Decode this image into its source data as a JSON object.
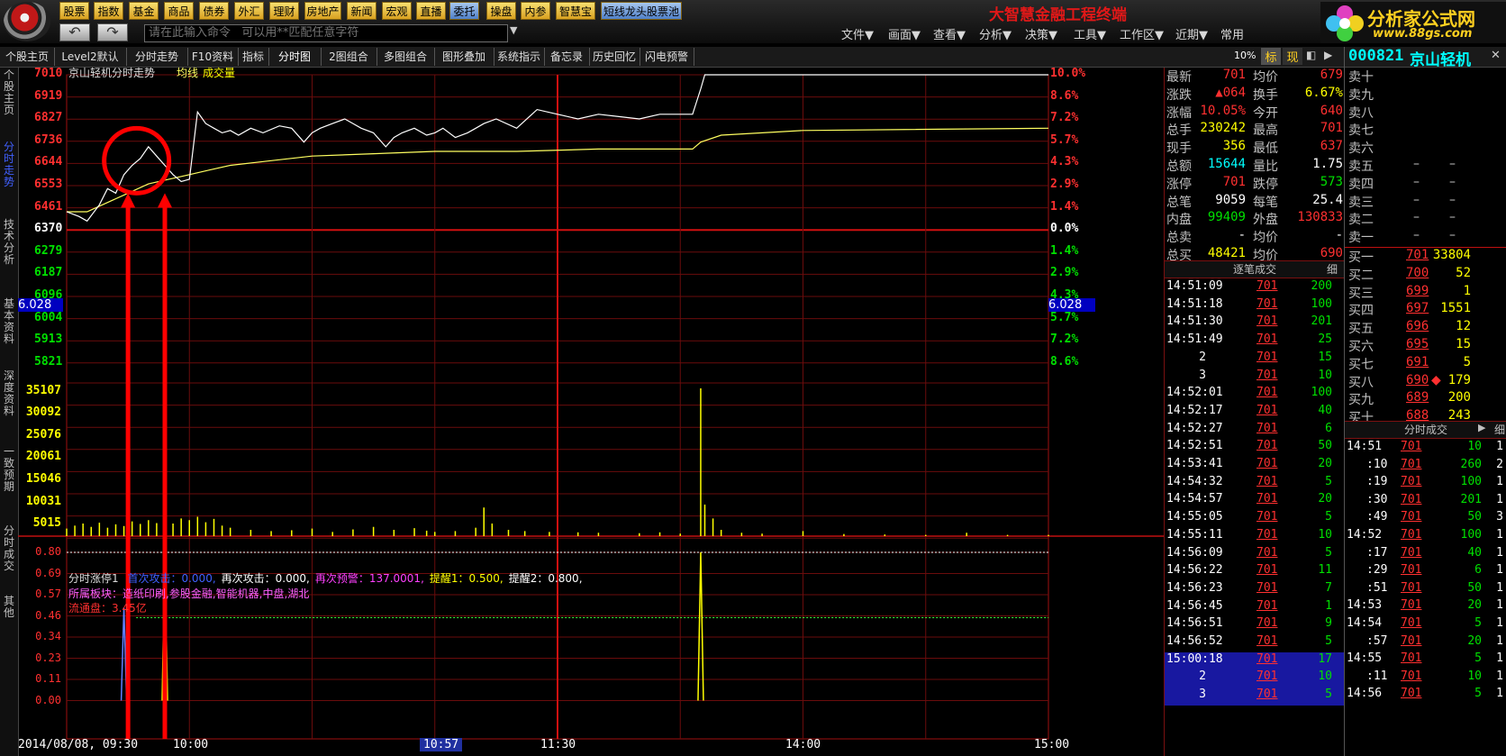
{
  "toolbar": {
    "buttons": [
      "股票",
      "指数",
      "基金",
      "商品",
      "债券",
      "外汇",
      "理财",
      "房地产",
      "新闻",
      "宏观",
      "直播",
      "委托",
      "操盘",
      "内参",
      "智慧宝",
      "短线龙头股票池"
    ],
    "command_placeholder": "请在此输入命令   可以用**匹配任意字符",
    "app_title": "大智慧金融工程终端",
    "menus": [
      "文件▼",
      "画面▼",
      "查看▼",
      "分析▼",
      "决策▼",
      "工具▼",
      "工作区▼",
      "近期▼",
      "常用"
    ],
    "brand_name": "分析家公式网",
    "brand_url": "www.88gs.com"
  },
  "tabs": [
    "个股主页",
    "Level2默认",
    "分时走势",
    "F10资料",
    "指标",
    "分时图",
    "2图组合",
    "多图组合",
    "图形叠加",
    "系统指示",
    "备忘录",
    "历史回忆",
    "闪电预警"
  ],
  "left_tabs": [
    "个股主页",
    "分时走势",
    "技术分析",
    "基本资料",
    "深度资料",
    "一致预期",
    "分时成交",
    "其他"
  ],
  "chart": {
    "header_name": "京山轻机分时走势",
    "header_avg": "均线",
    "header_vol": "成交量",
    "left_price_labels": [
      "7010",
      "6919",
      "6827",
      "6736",
      "6644",
      "6553",
      "6461",
      "6370",
      "6279",
      "6187",
      "6096",
      "6004",
      "5913",
      "5821"
    ],
    "cursor_price": "6.028",
    "right_pct_labels_up": [
      "10.0%",
      "8.6%",
      "7.2%",
      "5.7%",
      "4.3%",
      "2.9%",
      "1.4%"
    ],
    "zero_pct": "0.0%",
    "right_pct_labels_down": [
      "1.4%",
      "2.9%",
      "4.3%",
      "5.7%",
      "7.2%",
      "8.6%"
    ],
    "cursor_pct": "6.028",
    "volume_labels": [
      "35107",
      "30092",
      "25076",
      "20061",
      "15046",
      "10031",
      "5015"
    ],
    "indicator_title": "分时涨停1",
    "indicator_params": [
      {
        "label": "首次攻击",
        "value": "0.000",
        "color": "#4060ff"
      },
      {
        "label": "再次攻击",
        "value": "0.000",
        "color": "#ffffff"
      },
      {
        "label": "再次预警",
        "value": "137.0001",
        "color": "#ff40ff"
      },
      {
        "label": "提醒1",
        "value": "0.500",
        "color": "#ffff00"
      },
      {
        "label": "提醒2",
        "value": "0.800",
        "color": "#ffffff"
      }
    ],
    "sector_line": "所属板块：造纸印刷,参股金融,智能机器,中盘,湖北",
    "float_line": "流通盘：3.45亿",
    "indicator_labels": [
      "0.80",
      "0.69",
      "0.57",
      "0.46",
      "0.34",
      "0.23",
      "0.11",
      "0.00"
    ],
    "time_labels": [
      "2014/08/08, 09:30",
      "10:00",
      "10:57",
      "11:30",
      "14:00",
      "15:00"
    ],
    "price_series": [
      [
        0,
        6.42
      ],
      [
        3,
        6.4
      ],
      [
        5,
        6.38
      ],
      [
        8,
        6.45
      ],
      [
        10,
        6.52
      ],
      [
        12,
        6.5
      ],
      [
        14,
        6.58
      ],
      [
        16,
        6.62
      ],
      [
        18,
        6.65
      ],
      [
        20,
        6.7
      ],
      [
        22,
        6.66
      ],
      [
        24,
        6.62
      ],
      [
        26,
        6.58
      ],
      [
        28,
        6.55
      ],
      [
        30,
        6.56
      ],
      [
        32,
        6.85
      ],
      [
        34,
        6.8
      ],
      [
        36,
        6.78
      ],
      [
        38,
        6.76
      ],
      [
        40,
        6.77
      ],
      [
        42,
        6.75
      ],
      [
        45,
        6.78
      ],
      [
        48,
        6.76
      ],
      [
        52,
        6.79
      ],
      [
        55,
        6.78
      ],
      [
        58,
        6.72
      ],
      [
        60,
        6.76
      ],
      [
        62,
        6.78
      ],
      [
        65,
        6.8
      ],
      [
        68,
        6.82
      ],
      [
        70,
        6.8
      ],
      [
        72,
        6.78
      ],
      [
        75,
        6.76
      ],
      [
        78,
        6.7
      ],
      [
        80,
        6.74
      ],
      [
        82,
        6.76
      ],
      [
        85,
        6.78
      ],
      [
        88,
        6.75
      ],
      [
        90,
        6.76
      ],
      [
        92,
        6.78
      ],
      [
        95,
        6.74
      ],
      [
        98,
        6.76
      ],
      [
        100,
        6.78
      ],
      [
        102,
        6.8
      ],
      [
        105,
        6.82
      ],
      [
        110,
        6.78
      ],
      [
        115,
        6.86
      ],
      [
        120,
        6.84
      ],
      [
        125,
        6.82
      ],
      [
        130,
        6.84
      ],
      [
        135,
        6.83
      ],
      [
        140,
        6.82
      ],
      [
        145,
        6.84
      ],
      [
        150,
        6.84
      ],
      [
        153,
        6.84
      ],
      [
        155,
        6.95
      ],
      [
        156,
        7.01
      ],
      [
        240,
        7.01
      ]
    ],
    "avg_series": [
      [
        0,
        6.42
      ],
      [
        5,
        6.42
      ],
      [
        10,
        6.46
      ],
      [
        15,
        6.5
      ],
      [
        20,
        6.54
      ],
      [
        25,
        6.56
      ],
      [
        30,
        6.58
      ],
      [
        35,
        6.6
      ],
      [
        40,
        6.62
      ],
      [
        50,
        6.64
      ],
      [
        60,
        6.66
      ],
      [
        75,
        6.67
      ],
      [
        90,
        6.68
      ],
      [
        110,
        6.68
      ],
      [
        130,
        6.69
      ],
      [
        153,
        6.69
      ],
      [
        155,
        6.72
      ],
      [
        160,
        6.75
      ],
      [
        180,
        6.77
      ],
      [
        240,
        6.78
      ]
    ],
    "volume_series": [
      [
        0,
        1800
      ],
      [
        2,
        2500
      ],
      [
        4,
        3000
      ],
      [
        6,
        2200
      ],
      [
        8,
        3200
      ],
      [
        10,
        2000
      ],
      [
        12,
        2800
      ],
      [
        14,
        2400
      ],
      [
        16,
        3500
      ],
      [
        18,
        2900
      ],
      [
        20,
        3800
      ],
      [
        22,
        3100
      ],
      [
        24,
        4000
      ],
      [
        26,
        3000
      ],
      [
        28,
        4200
      ],
      [
        30,
        3800
      ],
      [
        32,
        4600
      ],
      [
        34,
        3300
      ],
      [
        36,
        4100
      ],
      [
        38,
        2500
      ],
      [
        40,
        2000
      ],
      [
        45,
        1500
      ],
      [
        50,
        1200
      ],
      [
        55,
        1400
      ],
      [
        60,
        1800
      ],
      [
        65,
        1000
      ],
      [
        70,
        1600
      ],
      [
        75,
        2200
      ],
      [
        80,
        1500
      ],
      [
        85,
        1900
      ],
      [
        88,
        1300
      ],
      [
        90,
        1000
      ],
      [
        95,
        1200
      ],
      [
        100,
        2000
      ],
      [
        102,
        6800
      ],
      [
        104,
        3000
      ],
      [
        108,
        1500
      ],
      [
        112,
        1200
      ],
      [
        118,
        1000
      ],
      [
        125,
        900
      ],
      [
        130,
        800
      ],
      [
        140,
        700
      ],
      [
        145,
        900
      ],
      [
        150,
        600
      ],
      [
        155,
        35107
      ],
      [
        156,
        7500
      ],
      [
        158,
        4200
      ],
      [
        160,
        1500
      ],
      [
        165,
        800
      ],
      [
        170,
        600
      ],
      [
        180,
        1200
      ],
      [
        190,
        500
      ],
      [
        200,
        400
      ],
      [
        210,
        300
      ],
      [
        220,
        800
      ],
      [
        230,
        300
      ],
      [
        240,
        300
      ]
    ],
    "signal_series": [
      [
        14,
        0.5
      ],
      [
        24,
        0.8
      ],
      [
        155,
        0.8
      ]
    ]
  },
  "quote": {
    "rows": [
      {
        "l": "最新",
        "v": "701",
        "vc": "red",
        "l2": "均价",
        "v2": "679",
        "v2c": "red"
      },
      {
        "l": "涨跌",
        "v": "▲064",
        "vc": "red",
        "l2": "换手",
        "v2": "6.67%",
        "v2c": "yellow"
      },
      {
        "l": "涨幅",
        "v": "10.05%",
        "vc": "red",
        "l2": "今开",
        "v2": "640",
        "v2c": "red"
      },
      {
        "l": "总手",
        "v": "230242",
        "vc": "yellow",
        "l2": "最高",
        "v2": "701",
        "v2c": "red"
      },
      {
        "l": "现手",
        "v": "356",
        "vc": "yellow",
        "l2": "最低",
        "v2": "637",
        "v2c": "red"
      },
      {
        "l": "总额",
        "v": "15644",
        "vc": "cyan",
        "l2": "量比",
        "v2": "1.75",
        "v2c": "white"
      },
      {
        "l": "涨停",
        "v": "701",
        "vc": "red",
        "l2": "跌停",
        "v2": "573",
        "v2c": "green"
      },
      {
        "l": "总笔",
        "v": "9059",
        "vc": "white",
        "l2": "每笔",
        "v2": "25.4",
        "v2c": "white"
      },
      {
        "l": "内盘",
        "v": "99409",
        "vc": "green",
        "l2": "外盘",
        "v2": "130833",
        "v2c": "red"
      },
      {
        "l": "总卖",
        "v": "-",
        "vc": "white",
        "l2": "均价",
        "v2": "-",
        "v2c": "white"
      },
      {
        "l": "总买",
        "v": "48421",
        "vc": "yellow",
        "l2": "均价",
        "v2": "690",
        "v2c": "red"
      }
    ],
    "ticks_title": "逐笔成交",
    "ticks_btn": "细",
    "ticks": [
      [
        "14:51:09",
        "701",
        "200"
      ],
      [
        "14:51:18",
        "701",
        "100"
      ],
      [
        "14:51:30",
        "701",
        "201"
      ],
      [
        "14:51:49",
        "701",
        "25"
      ],
      [
        "2",
        "701",
        "15"
      ],
      [
        "3",
        "701",
        "10"
      ],
      [
        "14:52:01",
        "701",
        "100"
      ],
      [
        "14:52:17",
        "701",
        "40"
      ],
      [
        "14:52:27",
        "701",
        "6"
      ],
      [
        "14:52:51",
        "701",
        "50"
      ],
      [
        "14:53:41",
        "701",
        "20"
      ],
      [
        "14:54:32",
        "701",
        "5"
      ],
      [
        "14:54:57",
        "701",
        "20"
      ],
      [
        "14:55:05",
        "701",
        "5"
      ],
      [
        "14:55:11",
        "701",
        "10"
      ],
      [
        "14:56:09",
        "701",
        "5"
      ],
      [
        "14:56:22",
        "701",
        "11"
      ],
      [
        "14:56:23",
        "701",
        "7"
      ],
      [
        "14:56:45",
        "701",
        "1"
      ],
      [
        "14:56:51",
        "701",
        "9"
      ],
      [
        "14:56:52",
        "701",
        "5"
      ],
      [
        "15:00:18",
        "701",
        "17"
      ],
      [
        "2",
        "701",
        "10"
      ],
      [
        "3",
        "701",
        "5"
      ]
    ]
  },
  "book": {
    "code": "000821",
    "name": "京山轻机",
    "sells": [
      {
        "l": "卖十",
        "p": "",
        "q": ""
      },
      {
        "l": "卖九",
        "p": "",
        "q": ""
      },
      {
        "l": "卖八",
        "p": "",
        "q": ""
      },
      {
        "l": "卖七",
        "p": "",
        "q": ""
      },
      {
        "l": "卖六",
        "p": "",
        "q": ""
      },
      {
        "l": "卖五",
        "p": "–",
        "q": "–"
      },
      {
        "l": "卖四",
        "p": "–",
        "q": "–"
      },
      {
        "l": "卖三",
        "p": "–",
        "q": "–"
      },
      {
        "l": "卖二",
        "p": "–",
        "q": "–"
      },
      {
        "l": "卖一",
        "p": "–",
        "q": "–"
      }
    ],
    "buys": [
      {
        "l": "买一",
        "p": "701",
        "q": "33804"
      },
      {
        "l": "买二",
        "p": "700",
        "q": "52"
      },
      {
        "l": "买三",
        "p": "699",
        "q": "1"
      },
      {
        "l": "买四",
        "p": "697",
        "q": "1551"
      },
      {
        "l": "买五",
        "p": "696",
        "q": "12"
      },
      {
        "l": "买六",
        "p": "695",
        "q": "15"
      },
      {
        "l": "买七",
        "p": "691",
        "q": "5"
      },
      {
        "l": "买八",
        "p": "690",
        "q": "179",
        "mark": "◆"
      },
      {
        "l": "买九",
        "p": "689",
        "q": "200"
      },
      {
        "l": "买十",
        "p": "688",
        "q": "243"
      }
    ],
    "ticks_title": "分时成交",
    "ticks_btn": "细",
    "ticks": [
      [
        "14:51",
        "701",
        "10",
        "1"
      ],
      [
        ":10",
        "701",
        "260",
        "2"
      ],
      [
        ":19",
        "701",
        "100",
        "1"
      ],
      [
        ":30",
        "701",
        "201",
        "1"
      ],
      [
        ":49",
        "701",
        "50",
        "3"
      ],
      [
        "14:52",
        "701",
        "100",
        "1"
      ],
      [
        ":17",
        "701",
        "40",
        "1"
      ],
      [
        ":29",
        "701",
        "6",
        "1"
      ],
      [
        ":51",
        "701",
        "50",
        "1"
      ],
      [
        "14:53",
        "701",
        "20",
        "1"
      ],
      [
        "14:54",
        "701",
        "5",
        "1"
      ],
      [
        ":57",
        "701",
        "20",
        "1"
      ],
      [
        "14:55",
        "701",
        "5",
        "1"
      ],
      [
        ":11",
        "701",
        "10",
        "1"
      ],
      [
        "14:56",
        "701",
        "5",
        "1"
      ]
    ]
  },
  "colors": {
    "grid": "#8b0000",
    "price": "#ffffff",
    "avg": "#ffff60",
    "volume": "#ffff00",
    "accent": "#ff0000"
  }
}
